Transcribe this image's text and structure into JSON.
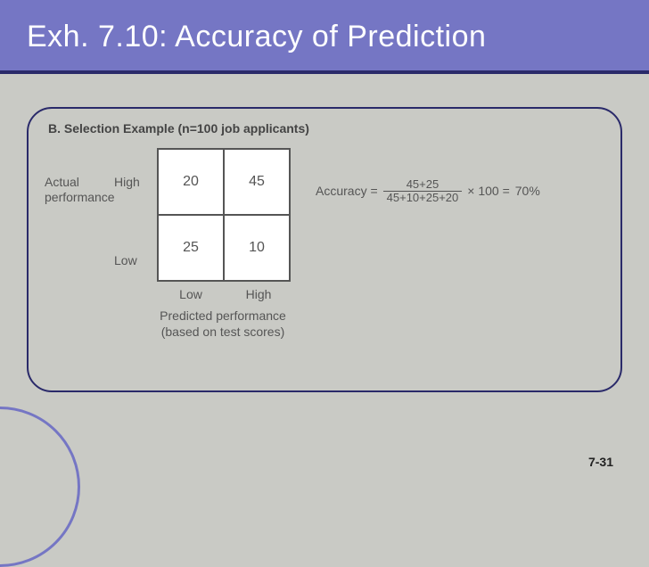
{
  "title": "Exh. 7.10:  Accuracy of Prediction",
  "section_label": "B.  Selection Example (n=100 job applicants)",
  "y_axis": {
    "group_label_line1": "Actual",
    "group_label_line2": "performance",
    "high": "High",
    "low": "Low"
  },
  "x_axis": {
    "group_label_line1": "Predicted performance",
    "group_label_line2": "(based on test scores)",
    "low": "Low",
    "high": "High"
  },
  "matrix": {
    "high_low": "20",
    "high_high": "45",
    "low_low": "25",
    "low_high": "10"
  },
  "formula": {
    "prefix": "Accuracy =",
    "numerator": "45+25",
    "denominator": "45+10+25+20",
    "mult": "× 100 =",
    "result": "70%"
  },
  "page_number": "7-31"
}
